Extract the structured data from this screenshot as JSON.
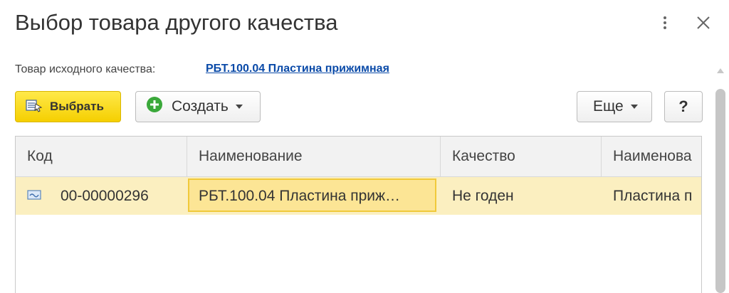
{
  "window": {
    "title": "Выбор товара другого качества",
    "more_icon": "vertical-dots-icon",
    "close_icon": "close-icon"
  },
  "source_item": {
    "label": "Товар исходного качества:",
    "value": "РБТ.100.04 Пластина прижимная"
  },
  "toolbar": {
    "select_label": "Выбрать",
    "create_label": "Создать",
    "more_label": "Еще",
    "help_label": "?",
    "create_icon_color": "#3aa83a",
    "select_color": "#f7d300"
  },
  "table": {
    "columns": [
      "Код",
      "Наименование",
      "Качество",
      "Наименова"
    ],
    "rows": [
      {
        "icon": "item-card-icon",
        "code": "00-00000296",
        "name": "РБТ.100.04 Пластина приж…",
        "quality": "Не годен",
        "name2": "Пластина п"
      }
    ]
  }
}
